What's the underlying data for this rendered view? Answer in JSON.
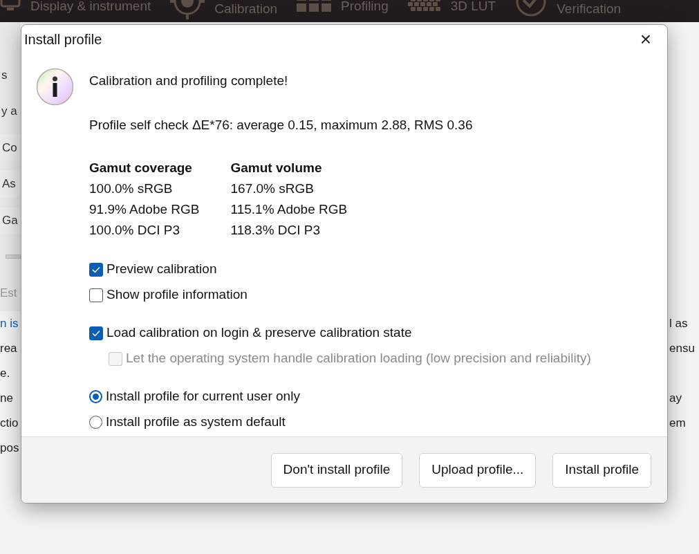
{
  "toolbar": {
    "tabs": [
      {
        "label": "Display & instrument"
      },
      {
        "label": "Calibration"
      },
      {
        "label": "Profiling"
      },
      {
        "label": "3D LUT"
      },
      {
        "label": "Verification"
      }
    ]
  },
  "background": {
    "left_items": [
      {
        "text": "s",
        "kind": "label"
      },
      {
        "text": "y a",
        "kind": "label"
      },
      {
        "text": "Co",
        "kind": "field"
      },
      {
        "text": "As",
        "kind": "field"
      },
      {
        "text": "Ga",
        "kind": "field"
      },
      {
        "kind": "slider"
      },
      {
        "text": "Est",
        "kind": "muted"
      }
    ],
    "lines": [
      {
        "left": "n is",
        "link": true,
        "right": "l as"
      },
      {
        "left": "rea",
        "link": false,
        "right": "ensu"
      },
      {
        "left": "e.",
        "link": false
      },
      {
        "left": "ne",
        "link": false,
        "right": "ay"
      },
      {
        "left": "ctio",
        "link": false,
        "right": "em"
      },
      {
        "left": "pos",
        "link": false
      }
    ]
  },
  "dialog": {
    "title": "Install profile",
    "close": "×",
    "heading": "Calibration and profiling complete!",
    "self_check": "Profile self check ΔE*76: average 0.15, maximum 2.88, RMS 0.36",
    "columns": [
      {
        "title": "Gamut coverage",
        "rows": [
          "100.0% sRGB",
          "91.9% Adobe RGB",
          "100.0% DCI P3"
        ]
      },
      {
        "title": "Gamut volume",
        "rows": [
          "167.0% sRGB",
          "115.1% Adobe RGB",
          "118.3% DCI P3"
        ]
      }
    ],
    "option_groups": [
      [
        {
          "kind": "checkbox",
          "label": "Preview calibration",
          "checked": true,
          "disabled": false
        },
        {
          "kind": "checkbox",
          "label": "Show profile information",
          "checked": false,
          "disabled": false
        }
      ],
      [
        {
          "kind": "checkbox",
          "label": "Load calibration on login & preserve calibration state",
          "checked": true,
          "disabled": false,
          "children": [
            {
              "kind": "checkbox",
              "label": "Let the operating system handle calibration loading (low precision and reliability)",
              "checked": false,
              "disabled": true
            }
          ]
        }
      ],
      [
        {
          "kind": "radio",
          "label": "Install profile for current user only",
          "selected": true
        },
        {
          "kind": "radio",
          "label": "Install profile as system default",
          "selected": false
        }
      ]
    ],
    "buttons": [
      "Don't install profile",
      "Upload profile...",
      "Install profile"
    ]
  }
}
